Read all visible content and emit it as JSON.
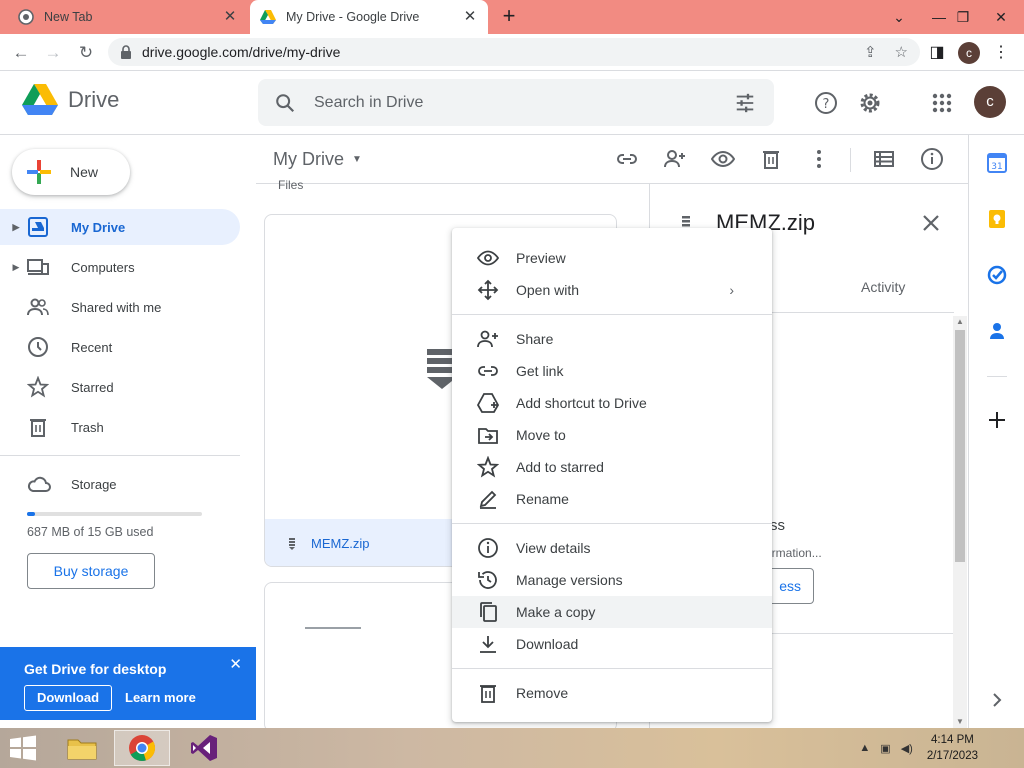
{
  "browser": {
    "tabs": [
      {
        "title": "New Tab",
        "active": false
      },
      {
        "title": "My Drive - Google Drive",
        "active": true
      }
    ],
    "url": "drive.google.com/drive/my-drive",
    "profile_initial": "c"
  },
  "header": {
    "logo_text": "Drive",
    "search_placeholder": "Search in Drive",
    "avatar_initial": "c"
  },
  "sidebar": {
    "new_label": "New",
    "items": [
      {
        "label": "My Drive",
        "icon": "my-drive-icon",
        "active": true
      },
      {
        "label": "Computers",
        "icon": "computer-icon",
        "active": false
      },
      {
        "label": "Shared with me",
        "icon": "people-icon",
        "active": false
      },
      {
        "label": "Recent",
        "icon": "clock-icon",
        "active": false
      },
      {
        "label": "Starred",
        "icon": "star-icon",
        "active": false
      },
      {
        "label": "Trash",
        "icon": "trash-icon",
        "active": false
      }
    ],
    "storage_label": "Storage",
    "storage_used_fraction": 0.045,
    "storage_text": "687 MB of 15 GB used",
    "buy_storage_label": "Buy storage",
    "promo": {
      "title": "Get Drive for desktop",
      "download_label": "Download",
      "learn_more_label": "Learn more"
    }
  },
  "main": {
    "title": "My Drive",
    "section_label": "Files",
    "files": [
      {
        "name": "MEMZ.zip",
        "selected": true
      }
    ]
  },
  "details": {
    "title": "MEMZ.zip",
    "tab_activity": "Activity",
    "partial_text_1": "ss",
    "partial_text_2": "ormation...",
    "partial_button": "ess"
  },
  "context_menu": {
    "groups": [
      [
        {
          "label": "Preview",
          "icon": "eye-icon"
        },
        {
          "label": "Open with",
          "icon": "move-arrows-icon",
          "submenu": true
        }
      ],
      [
        {
          "label": "Share",
          "icon": "person-add-icon"
        },
        {
          "label": "Get link",
          "icon": "link-icon"
        },
        {
          "label": "Add shortcut to Drive",
          "icon": "shortcut-icon"
        },
        {
          "label": "Move to",
          "icon": "move-folder-icon"
        },
        {
          "label": "Add to starred",
          "icon": "star-icon"
        },
        {
          "label": "Rename",
          "icon": "pencil-icon"
        }
      ],
      [
        {
          "label": "View details",
          "icon": "info-icon"
        },
        {
          "label": "Manage versions",
          "icon": "history-icon"
        },
        {
          "label": "Make a copy",
          "icon": "copy-icon",
          "hover": true
        },
        {
          "label": "Download",
          "icon": "download-icon"
        }
      ],
      [
        {
          "label": "Remove",
          "icon": "trash-icon"
        }
      ]
    ]
  },
  "taskbar": {
    "time": "4:14 PM",
    "date": "2/17/2023"
  }
}
